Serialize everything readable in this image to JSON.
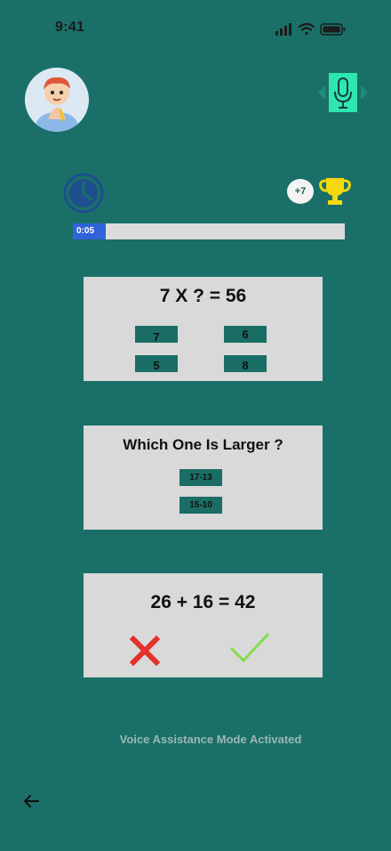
{
  "status_bar": {
    "time": "9:41",
    "signal_icon": "signal-icon",
    "wifi_icon": "wifi-icon",
    "battery_icon": "battery-icon"
  },
  "header": {
    "avatar_icon": "avatar-icon",
    "mic_icon": "microphone-icon"
  },
  "stats": {
    "timer_icon": "clock-icon",
    "points": "+7",
    "trophy_icon": "trophy-icon"
  },
  "progress": {
    "label": "0:05",
    "fraction": 0.12
  },
  "questions": [
    {
      "prompt": "7 X ?  = 56",
      "options": [
        "7",
        "6",
        "5",
        "8"
      ]
    },
    {
      "prompt": "Which One Is Larger ?",
      "options": [
        "17-13",
        "15-10"
      ]
    },
    {
      "prompt": "26 + 16 = 42",
      "false_icon": "cross-icon",
      "true_icon": "checkmark-icon"
    }
  ],
  "footer": {
    "voice_text": "Voice Assistance Mode Activated",
    "back_icon": "back-arrow-icon"
  },
  "colors": {
    "background": "#1a7068",
    "card": "#d9d9d9",
    "option": "#1a6e66",
    "accent": "#2f63d8",
    "cross": "#e3322b",
    "check": "#7fe04a",
    "trophy": "#f5d90a",
    "mic_bg": "#2ee6b0"
  }
}
